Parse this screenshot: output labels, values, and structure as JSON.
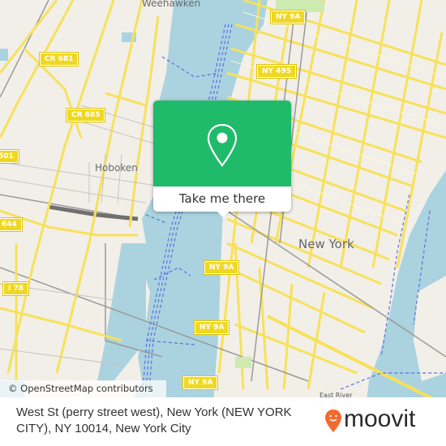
{
  "map": {
    "places": [
      {
        "name": "Weehawken",
        "size": "mid"
      },
      {
        "name": "Hoboken",
        "size": "mid"
      },
      {
        "name": "New York",
        "size": "big"
      },
      {
        "name": "East River",
        "size": "small"
      }
    ],
    "shields": [
      "CR 681",
      "CR 685",
      "501",
      "644",
      "I 78",
      "NY 9A",
      "NY 495",
      "NY 9A",
      "NY 9A",
      "NY 9A"
    ],
    "colors": {
      "water": "#aad3df",
      "land": "#f2efe9",
      "road": "#f7e15a",
      "ferry": "#5b6fe0",
      "rail": "#999999"
    }
  },
  "popup": {
    "icon": "location-pin-icon",
    "button_label": "Take me there",
    "color": "#1fba6a"
  },
  "attribution": "© OpenStreetMap contributors",
  "footer": {
    "address": "West St (perry street west), New York (NEW YORK CITY), NY 10014, New York City",
    "logo_text": "moovit",
    "logo_color": "#f26a2e"
  }
}
